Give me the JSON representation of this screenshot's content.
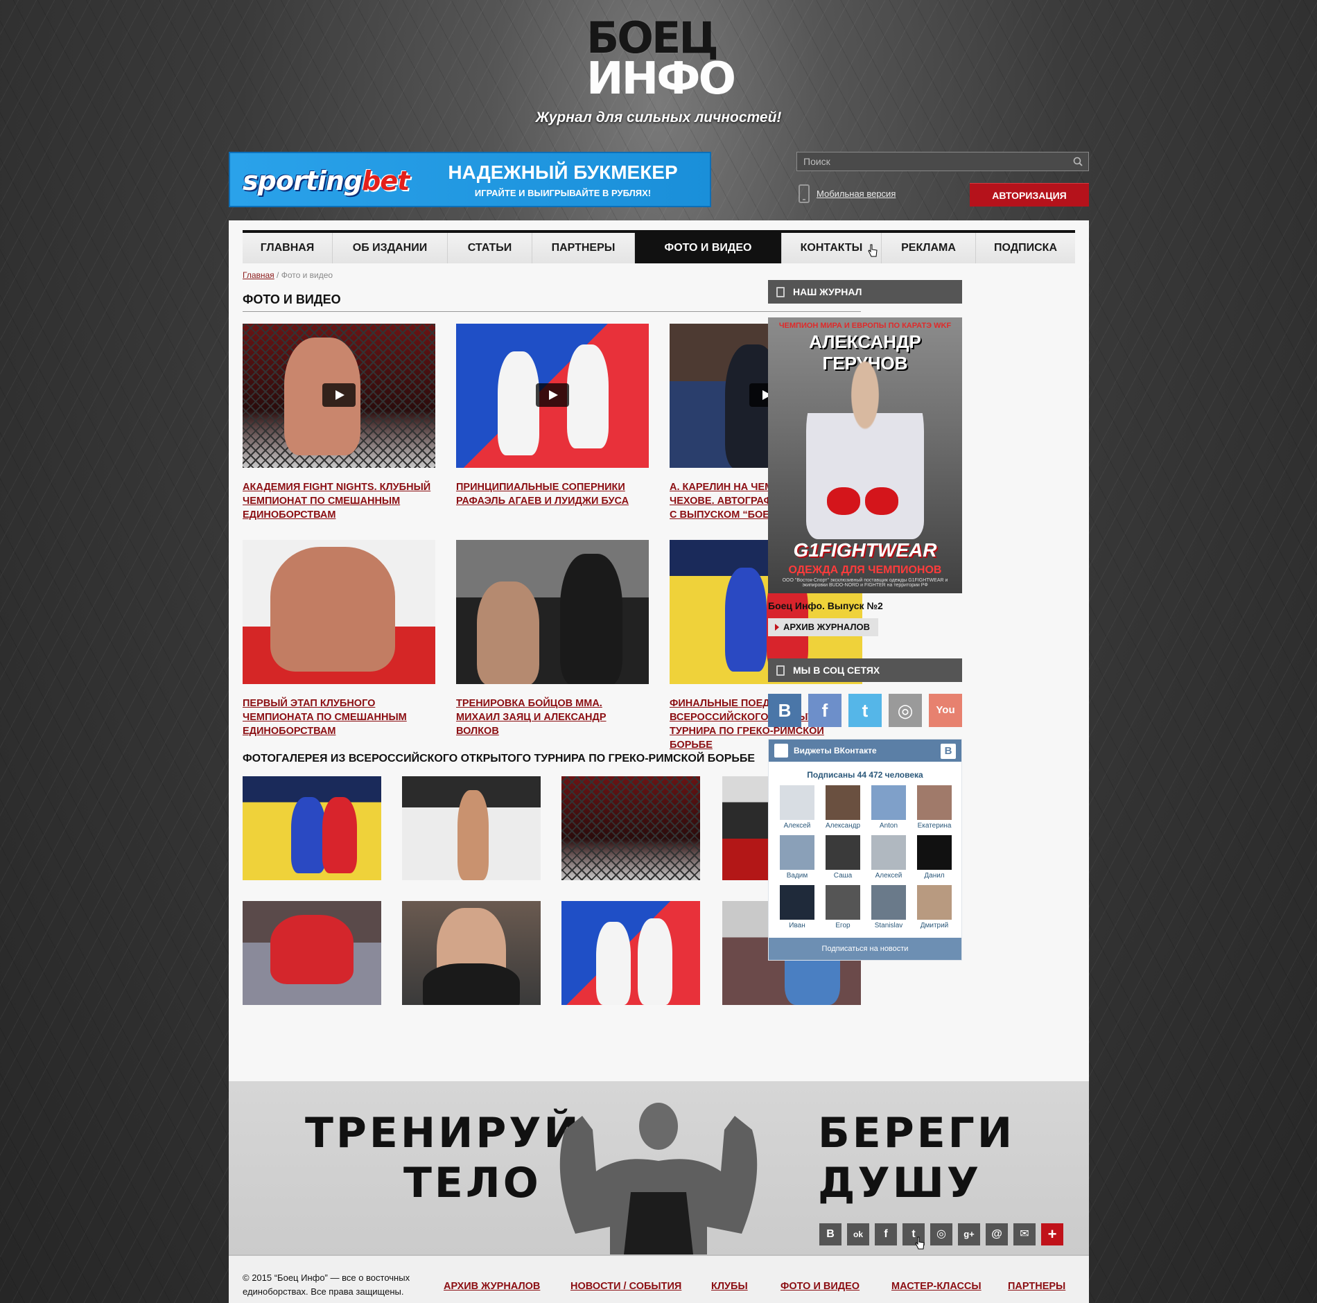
{
  "header": {
    "logo_line1": "БОЕЦ",
    "logo_line2": "ИНФО",
    "tagline": "Журнал для сильных личностей!"
  },
  "ad_banner": {
    "brand_a": "sporting",
    "brand_b": "bet",
    "headline": "НАДЕЖНЫЙ БУКМЕКЕР",
    "subline": "ИГРАЙТЕ И ВЫИГРЫВАЙТЕ В РУБЛЯХ!"
  },
  "search": {
    "placeholder": "Поиск"
  },
  "mobile_link": "Мобильная версия",
  "auth_button": "АВТОРИЗАЦИЯ",
  "nav": {
    "items": [
      {
        "label": "ГЛАВНАЯ"
      },
      {
        "label": "ОБ ИЗДАНИИ"
      },
      {
        "label": "СТАТЬИ"
      },
      {
        "label": "ПАРТНЕРЫ"
      },
      {
        "label": "ФОТО И ВИДЕО"
      },
      {
        "label": "КОНТАКТЫ"
      },
      {
        "label": "РЕКЛАМА"
      },
      {
        "label": "ПОДПИСКА"
      }
    ],
    "active": "ФОТО И ВИДЕО"
  },
  "breadcrumb": {
    "home": "Главная",
    "current": " / Фото и видео"
  },
  "page_title": "ФОТО И ВИДЕО",
  "cards": [
    {
      "title": "АКАДЕМИЯ FIGHT NIGHTS. КЛУБНЫЙ ЧЕМПИОНАТ ПО СМЕШАННЫМ ЕДИНОБОРСТВАМ",
      "video": true
    },
    {
      "title": "ПРИНЦИПИАЛЬНЫЕ СОПЕРНИКИ РАФАЭЛЬ АГАЕВ  И ЛУИДЖИ БУСА",
      "video": true
    },
    {
      "title": "А. КАРЕЛИН НА ЧЕМПИОНАТЕ В ЧЕХОВЕ. АВТОГРАФ ДЛЯ ЮНИОРОВ С ВЫПУСКОМ “БОЕЦ ИНФО”",
      "video": true
    },
    {
      "title": "ПЕРВЫЙ ЭТАП КЛУБНОГО ЧЕМПИОНАТА ПО СМЕШАННЫМ ЕДИНОБОРСТВАМ",
      "video": false
    },
    {
      "title": "ТРЕНИРОВКА БОЙЦОВ ММА. МИХАИЛ ЗАЯЦ И АЛЕКСАНДР ВОЛКОВ",
      "video": false
    },
    {
      "title": "ФИНАЛЬНЫЕ ПОЕДИНКИ ВСЕРОССИЙСКОГО ОТКРЫТОГО ТУРНИРА ПО ГРЕКО-РИМСКОЙ БОРЬБЕ",
      "video": false
    }
  ],
  "gallery": {
    "title": "ФОТОГАЛЕРЕЯ ИЗ ВСЕРОССИЙСКОГО ОТКРЫТОГО ТУРНИРА ПО ГРЕКО-РИМСКОЙ БОРЬБЕ"
  },
  "sidebar": {
    "magazine_head": "НАШ ЖУРНАЛ",
    "cover": {
      "top_line": "ЧЕМПИОН МИРА И ЕВРОПЫ ПО КАРАТЭ WKF",
      "name": "АЛЕКСАНДР ГЕРУНОВ",
      "brand": "G1FIGHTWEAR",
      "slogan": "ОДЕЖДА ДЛЯ ЧЕМПИОНОВ",
      "small": "ООО \"Восток-Спорт\" эксклюзивный поставщик одежды G1FIGHTWEAR и экипировки BUDO-NORD и FIGHTER на территории РФ"
    },
    "issue_label": "Боец Инфо. Выпуск №2",
    "archive_button": "АРХИВ ЖУРНАЛОВ",
    "social_head": "МЫ В СОЦ СЕТЯХ",
    "social": [
      {
        "icon": "vk-icon",
        "glyph": "В",
        "color": "#4a76a8"
      },
      {
        "icon": "facebook-icon",
        "glyph": "f",
        "color": "#6d8fca"
      },
      {
        "icon": "twitter-icon",
        "glyph": "t",
        "color": "#55b6e8"
      },
      {
        "icon": "instagram-icon",
        "glyph": "◎",
        "color": "#9a9a9a"
      },
      {
        "icon": "youtube-icon",
        "glyph": "You",
        "color": "#e7816f"
      }
    ],
    "vk_widget": {
      "title": "Виджеты ВКонтакте",
      "subscribers": "Подписаны 44 472 человека",
      "people": [
        "Алексей",
        "Александр",
        "Anton",
        "Екатерина",
        "Вадим",
        "Саша",
        "Алексей",
        "Данил",
        "Иван",
        "Егор",
        "Stanislav",
        "Дмитрий"
      ],
      "subscribe_button": "Подписаться на новости"
    }
  },
  "promo": {
    "left_line1": "ТРЕНИРУЙ",
    "left_line2": "ТЕЛО",
    "right_line1": "БЕРЕГИ",
    "right_line2": "ДУШУ",
    "share": [
      {
        "icon": "vk-icon",
        "glyph": "В"
      },
      {
        "icon": "odnoklassniki-icon",
        "glyph": "ok"
      },
      {
        "icon": "facebook-icon",
        "glyph": "f"
      },
      {
        "icon": "twitter-icon",
        "glyph": "t"
      },
      {
        "icon": "instagram-icon",
        "glyph": "◎"
      },
      {
        "icon": "google-plus-icon",
        "glyph": "g+"
      },
      {
        "icon": "mail-ru-icon",
        "glyph": "@"
      },
      {
        "icon": "email-icon",
        "glyph": "✉"
      },
      {
        "icon": "plus-icon",
        "glyph": "+"
      }
    ]
  },
  "footer": {
    "copyright": "© 2015 “Боец Инфо” — все о восточных единоборствах. Все права защищены.",
    "links": [
      "АРХИВ ЖУРНАЛОВ",
      "НОВОСТИ / СОБЫТИЯ",
      "КЛУБЫ",
      "ФОТО И ВИДЕО",
      "МАСТЕР-КЛАССЫ",
      "ПАРТНЕРЫ"
    ]
  }
}
